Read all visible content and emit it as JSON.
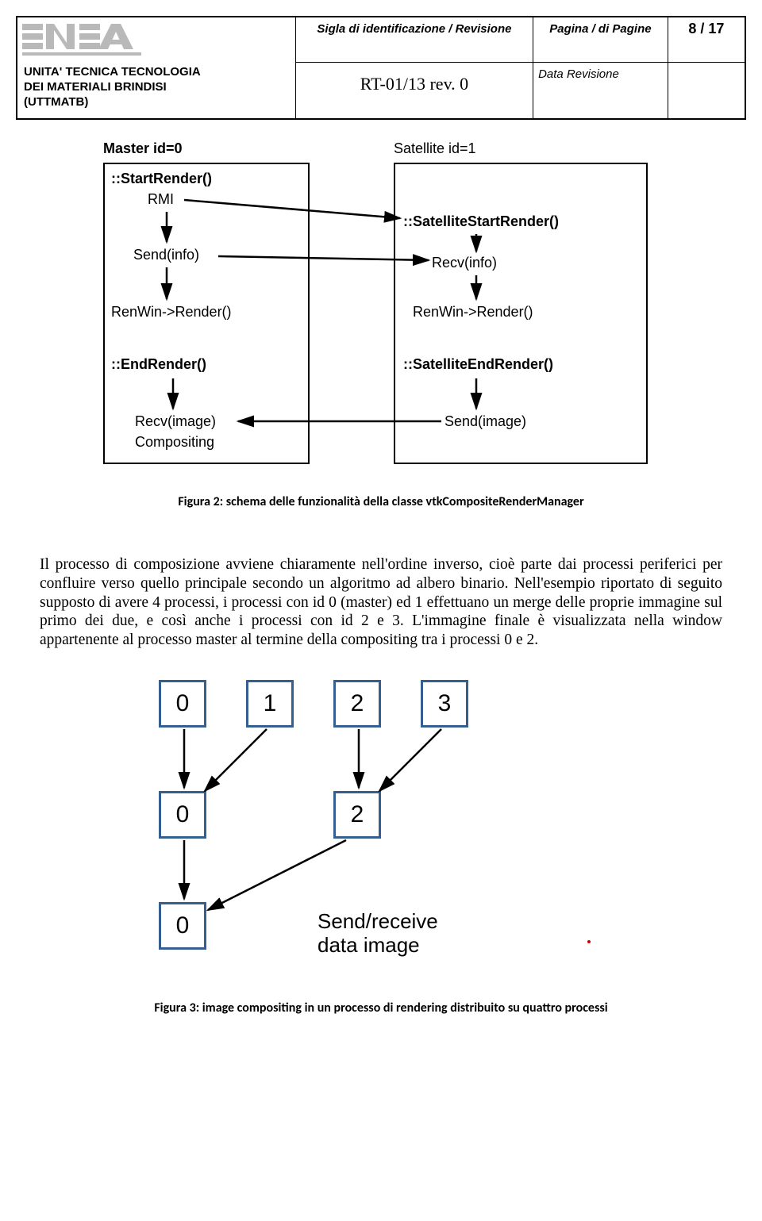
{
  "header": {
    "col_sigla_label": "Sigla di identificazione / Revisione",
    "col_pagina_label": "Pagina / di Pagine",
    "page_num": "8 / 17",
    "unit_line1": "UNITA' TECNICA TECNOLOGIA",
    "unit_line2": "DEI MATERIALI BRINDISI",
    "unit_line3": "(UTTMATB)",
    "doc_code": "RT-01/13 rev. 0",
    "data_rev_label": "Data Revisione",
    "logo_text": "ENEA"
  },
  "figure2": {
    "master_title": "Master id=0",
    "sat_title": "Satellite id=1",
    "m_start": "::StartRender()",
    "m_rmi": "RMI",
    "m_send": "Send(info)",
    "m_renwin": "RenWin->Render()",
    "m_end": "::EndRender()",
    "m_recv": "Recv(image)",
    "m_comp": "Compositing",
    "s_start": "::SatelliteStartRender()",
    "s_recv": "Recv(info)",
    "s_renwin": "RenWin->Render()",
    "s_end": "::SatelliteEndRender()",
    "s_send": "Send(image)",
    "caption": "Figura 2: schema delle funzionalità della classe vtkCompositeRenderManager"
  },
  "paragraph": "Il processo di composizione avviene chiaramente nell'ordine inverso, cioè parte dai processi periferici per confluire verso quello principale secondo un algoritmo ad albero binario. Nell'esempio riportato di seguito supposto di avere 4 processi, i processi con id 0 (master) ed 1 effettuano un merge delle proprie immagine sul primo dei due, e così anche i processi con id 2 e 3. L'immagine finale è visualizzata nella window appartenente al processo master al termine della compositing tra i processi 0 e 2.",
  "figure3": {
    "top_vals": [
      "0",
      "1",
      "2",
      "3"
    ],
    "mid_vals": [
      "0",
      "2"
    ],
    "bot_val": "0",
    "sendrecv_line1": "Send/receive",
    "sendrecv_line2": "data image",
    "caption": "Figura 3: image compositing in un processo di rendering distribuito su quattro processi"
  }
}
